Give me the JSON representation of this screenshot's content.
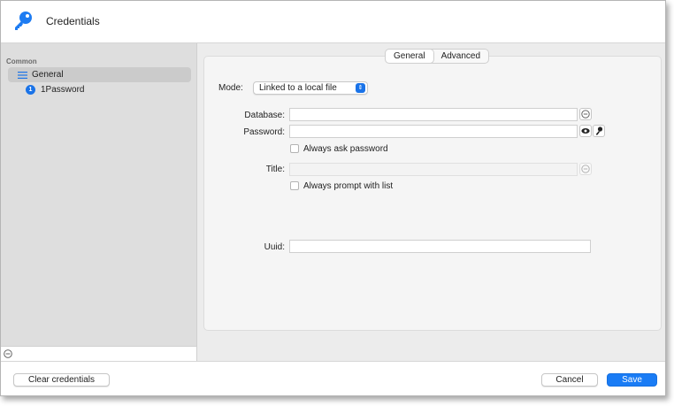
{
  "window": {
    "title": "Credentials"
  },
  "sidebar": {
    "section_label": "Common",
    "items": [
      {
        "label": "General",
        "icon": "list-icon",
        "selected": true
      },
      {
        "label": "1Password",
        "icon": "1password-icon",
        "badge": "1",
        "selected": false
      }
    ]
  },
  "tabs": [
    {
      "label": "General",
      "active": true
    },
    {
      "label": "Advanced",
      "active": false
    }
  ],
  "form": {
    "mode_label": "Mode:",
    "mode_value": "Linked to a local file",
    "database_label": "Database:",
    "database_value": "",
    "password_label": "Password:",
    "password_value": "",
    "always_ask_password_label": "Always ask password",
    "always_ask_password_checked": false,
    "title_label": "Title:",
    "title_value": "",
    "always_prompt_list_label": "Always prompt with list",
    "always_prompt_list_checked": false,
    "uuid_label": "Uuid:",
    "uuid_value": ""
  },
  "buttons": {
    "clear_credentials": "Clear credentials",
    "cancel": "Cancel",
    "save": "Save"
  },
  "colors": {
    "accent": "#1a7cf5",
    "selection": "#cbcbcb"
  }
}
